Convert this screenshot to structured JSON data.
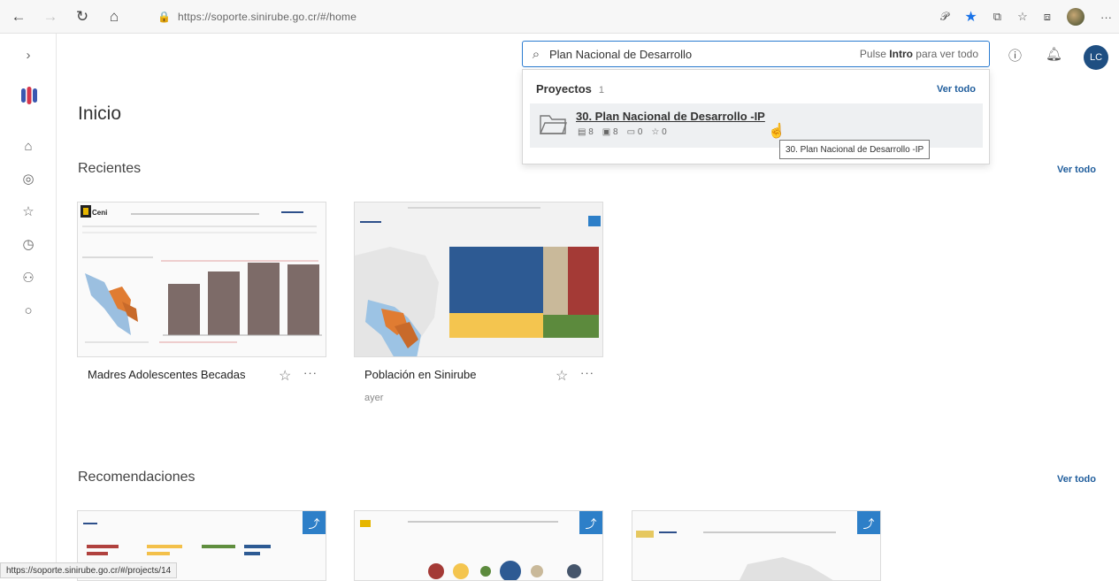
{
  "browser": {
    "url": "https://soporte.sinirube.go.cr/#/home",
    "back_icon": "arrow-left-icon",
    "forward_icon": "arrow-right-icon",
    "reload_icon": "reload-icon",
    "home_icon": "home-icon"
  },
  "header": {
    "search_value": "Plan Nacional de Desarrollo",
    "search_hint_prefix": "Pulse ",
    "search_hint_key": "Intro",
    "search_hint_suffix": " para ver todo",
    "user_initials": "LC"
  },
  "dropdown": {
    "section": "Proyectos",
    "count": "1",
    "see_all": "Ver todo",
    "item_name": "30. Plan Nacional de Desarrollo -IP",
    "meta": [
      "8",
      "8",
      "0",
      "0"
    ],
    "tooltip": "30. Plan Nacional de Desarrollo -IP"
  },
  "page": {
    "title": "Inicio",
    "recientes_title": "Recientes",
    "recomendaciones_title": "Recomendaciones",
    "see_all": "Ver todo"
  },
  "recientes": [
    {
      "name": "Madres Adolescentes Becadas",
      "sub": ""
    },
    {
      "name": "Población en Sinirube",
      "sub": "ayer"
    }
  ],
  "status_url": "https://soporte.sinirube.go.cr/#/projects/14",
  "colors": {
    "accent": "#2a7bd0",
    "link": "#1f5d9c",
    "avatar": "#1f4f82"
  }
}
